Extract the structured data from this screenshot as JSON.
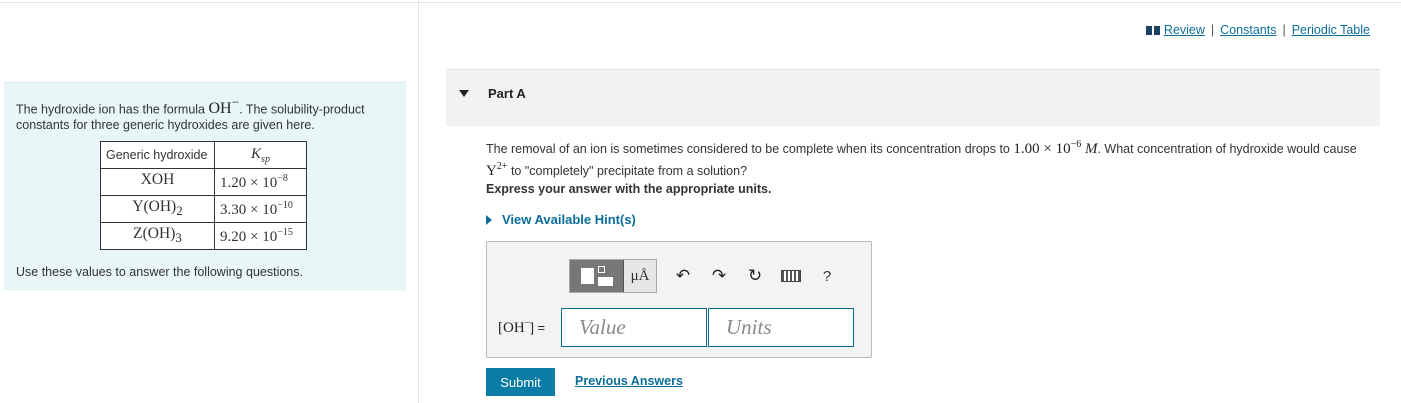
{
  "links": {
    "review": "Review",
    "separator": "|",
    "constants": "Constants",
    "periodic_table": "Periodic Table"
  },
  "intro": {
    "text_before": "The hydroxide ion has the formula ",
    "ion_formula": "OH",
    "ion_charge": "−",
    "text_after": ". The solubility-product constants for three generic hydroxides are given here.",
    "outro": "Use these values to answer the following questions."
  },
  "table": {
    "header_hydroxide": "Generic hydroxide",
    "header_ksp_main": "K",
    "header_ksp_sub": "sp",
    "rows": [
      {
        "formula": "XOH",
        "sub": "",
        "mantissa": "1.20 × 10",
        "exponent": "−8"
      },
      {
        "formula": "Y(OH)",
        "sub": "2",
        "mantissa": "3.30 × 10",
        "exponent": "−10"
      },
      {
        "formula": "Z(OH)",
        "sub": "3",
        "mantissa": "9.20 × 10",
        "exponent": "−15"
      }
    ]
  },
  "part": {
    "title": "Part A"
  },
  "question": {
    "text1": "The removal of an ion is sometimes considered to be complete when its concentration drops to ",
    "conc_mantissa": "1.00 × 10",
    "conc_exponent": "−6",
    "conc_unit": "M",
    "text2": ". What concentration of hydroxide would cause ",
    "ion": "Y",
    "ion_charge": "2+",
    "text3": " to \"completely\" precipitate from a solution?"
  },
  "instruction": "Express your answer with the appropriate units.",
  "hint": "View Available Hint(s)",
  "toolbar": {
    "unit_symbol": "μÅ",
    "undo": "↶",
    "redo": "↷",
    "reset": "↻",
    "help": "?"
  },
  "answer": {
    "label_main": "[OH",
    "label_charge": "−",
    "label_end": "] =",
    "value_placeholder": "Value",
    "units_placeholder": "Units"
  },
  "submit_label": "Submit",
  "previous_answers": "Previous Answers",
  "colors": {
    "link": "#0b6e99",
    "submit": "#0b7ca6",
    "intro_bg": "#e8f6f8"
  }
}
